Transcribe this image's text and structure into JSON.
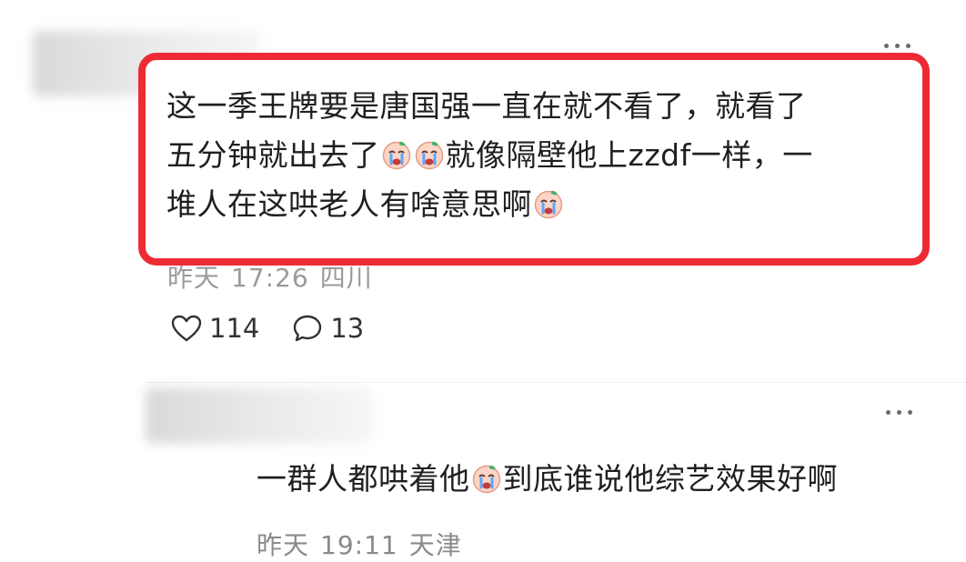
{
  "comments": [
    {
      "text_line1": "这一季王牌要是唐国强一直在就不看了，就看了",
      "text_line2_a": "五分钟就出去了",
      "text_line2_b": "就像隔壁他上zzdf一样，一",
      "text_line3": "堆人在这哄老人有啥意思啊",
      "meta_date": "昨天",
      "meta_time": "17:26",
      "meta_location": "四川",
      "likes": "114",
      "replies": "13",
      "emoji": "crying-face-emoji"
    },
    {
      "text_a": "一群人都哄着他",
      "text_b": "到底谁说他综艺效果好啊",
      "meta_date": "昨天",
      "meta_time": "19:11",
      "meta_location": "天津",
      "emoji": "crying-face-emoji"
    }
  ],
  "colors": {
    "highlight_border": "#ee2b35",
    "text": "#1f1f1f",
    "meta": "#8a8a8a"
  },
  "icons": {
    "like": "heart-outline-icon",
    "reply": "speech-bubble-icon",
    "more": "more-dots-icon"
  }
}
